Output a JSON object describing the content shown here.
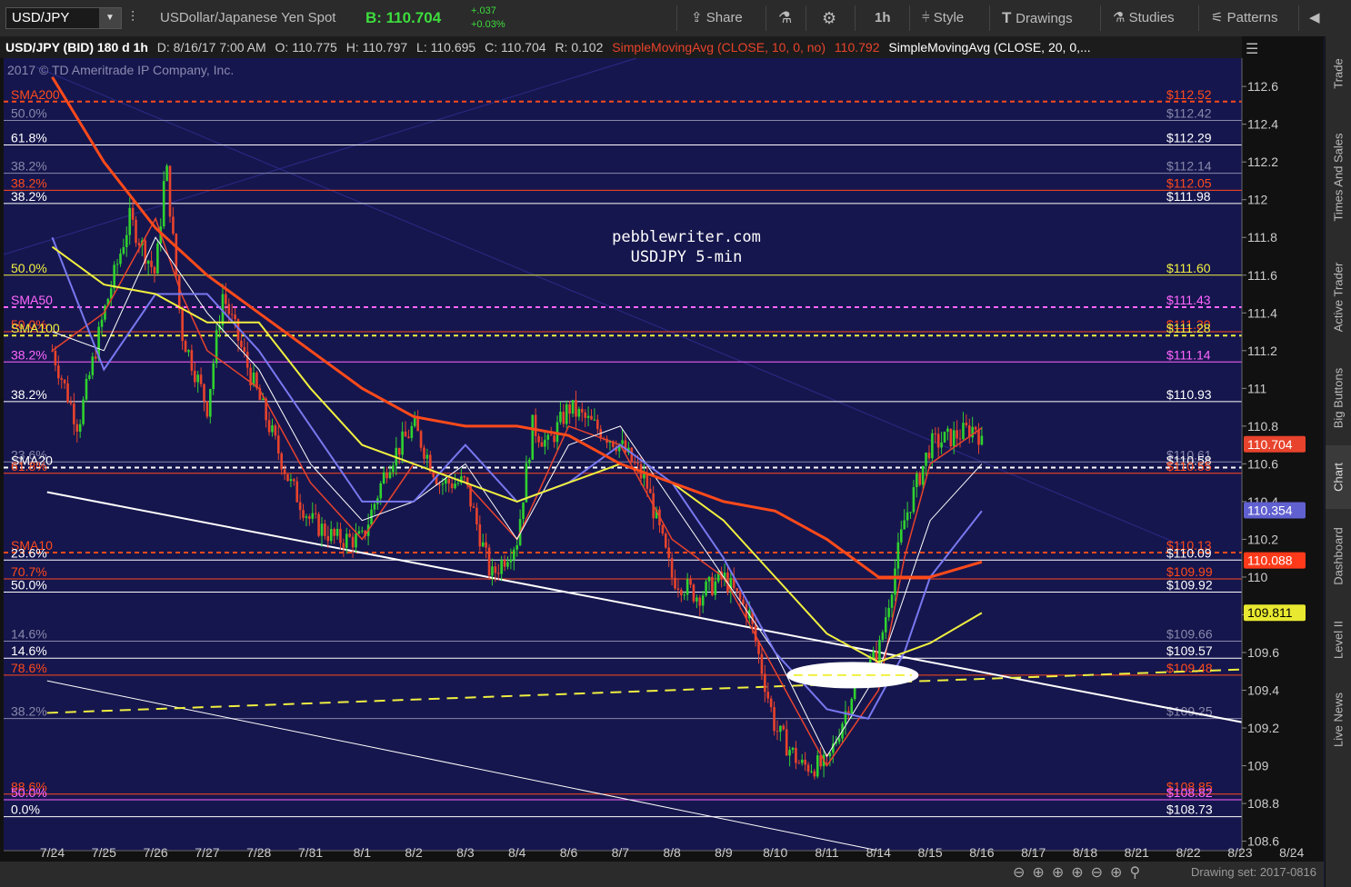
{
  "toolbar": {
    "symbol": "USD/JPY",
    "description": "USDollar/Japanese Yen Spot",
    "bid_label": "B: 110.704",
    "change_abs": "+.037",
    "change_pct": "+0.03%",
    "share": "Share",
    "interval": "1h",
    "style": "Style",
    "drawings": "Drawings",
    "studies": "Studies",
    "patterns": "Patterns"
  },
  "infobar": {
    "title": "USD/JPY (BID) 180 d 1h",
    "date": "D: 8/16/17 7:00 AM",
    "open": "O: 110.775",
    "high": "H: 110.797",
    "low": "L: 110.695",
    "close": "C: 110.704",
    "range": "R: 0.102",
    "sma10": "SimpleMovingAvg (CLOSE, 10, 0, no)",
    "sma10_val": "110.792",
    "sma20": "SimpleMovingAvg (CLOSE, 20, 0,..."
  },
  "side_tabs": [
    "Trade",
    "Times And Sales",
    "Active Trader",
    "Big Buttons",
    "Chart",
    "Dashboard",
    "Level II",
    "Live News"
  ],
  "bottom": {
    "drawing_set": "Drawing set: 2017-0816"
  },
  "colors": {
    "bg": "#16164e",
    "candle_up": "#2fd12f",
    "candle_down": "#e8432c",
    "sma10": "#e8432c",
    "sma20": "#ffffff",
    "sma50": "#7878f0",
    "sma100": "#f0f040",
    "sma200": "#ff4a1a"
  },
  "chart_data": {
    "type": "candlestick",
    "watermark": "2017 © TD Ameritrade IP Company, Inc.",
    "annotation": [
      "pebblewriter.com",
      "USDJPY 5-min"
    ],
    "x_ticks": [
      "7/24",
      "7/25",
      "7/26",
      "7/27",
      "7/28",
      "7/31",
      "8/1",
      "8/2",
      "8/3",
      "8/4",
      "8/6",
      "8/7",
      "8/8",
      "8/9",
      "8/10",
      "8/11",
      "8/14",
      "8/15",
      "8/16",
      "8/17",
      "8/18",
      "8/21",
      "8/22",
      "8/23",
      "8/24"
    ],
    "ylim": [
      108.55,
      112.75
    ],
    "y_ticks": [
      108.6,
      108.8,
      109,
      109.2,
      109.4,
      109.6,
      109.8,
      110,
      110.2,
      110.4,
      110.6,
      110.8,
      111,
      111.2,
      111.4,
      111.6,
      111.8,
      112,
      112.2,
      112.4,
      112.6
    ],
    "y_tick_labels": [
      "108.6",
      "108.8",
      "109",
      "109.2",
      "109.4",
      "109.6",
      "",
      "110",
      "110.2",
      "110.4",
      "110.6",
      "110.8",
      "111",
      "111.2",
      "111.4",
      "111.6",
      "111.8",
      "112",
      "112.2",
      "112.4",
      "112.6"
    ],
    "price_path": [
      [
        0,
        111.2
      ],
      [
        0.5,
        110.8
      ],
      [
        1,
        111.4
      ],
      [
        1.5,
        111.9
      ],
      [
        2,
        111.6
      ],
      [
        2.2,
        112.2
      ],
      [
        2.5,
        111.3
      ],
      [
        3,
        110.9
      ],
      [
        3.3,
        111.5
      ],
      [
        3.8,
        111.1
      ],
      [
        4.2,
        110.8
      ],
      [
        4.6,
        110.5
      ],
      [
        5,
        110.3
      ],
      [
        5.5,
        110.2
      ],
      [
        6,
        110.2
      ],
      [
        6.5,
        110.6
      ],
      [
        7,
        110.8
      ],
      [
        7.5,
        110.5
      ],
      [
        8,
        110.5
      ],
      [
        8.5,
        110.0
      ],
      [
        9,
        110.2
      ],
      [
        9.3,
        110.8
      ],
      [
        9.6,
        110.7
      ],
      [
        10,
        110.9
      ],
      [
        10.5,
        110.8
      ],
      [
        11,
        110.7
      ],
      [
        11.5,
        110.5
      ],
      [
        12,
        110.0
      ],
      [
        12.5,
        109.9
      ],
      [
        13,
        110.0
      ],
      [
        13.5,
        109.8
      ],
      [
        14,
        109.2
      ],
      [
        14.5,
        109.0
      ],
      [
        15,
        109.0
      ],
      [
        15.5,
        109.4
      ],
      [
        16,
        109.6
      ],
      [
        16.5,
        110.3
      ],
      [
        17,
        110.7
      ],
      [
        17.5,
        110.75
      ],
      [
        17.9,
        110.8
      ],
      [
        18,
        110.7
      ]
    ],
    "candle_base": [
      111.1,
      110.9,
      111.2,
      111.6,
      111.9,
      111.8,
      111.95,
      111.9,
      111.0,
      111.3,
      111.0,
      111.2,
      111.0,
      110.8,
      110.6,
      110.5,
      110.3,
      110.3,
      110.2,
      110.2,
      110.4,
      110.5,
      110.8,
      110.7,
      110.6,
      110.5,
      110.3,
      110.1,
      110.2,
      110.5,
      110.8,
      110.8,
      110.7,
      110.8,
      110.9,
      110.8,
      110.6,
      110.6,
      110.5,
      110.2,
      110.0,
      109.9,
      110.0,
      109.8,
      109.9,
      109.5,
      109.2,
      109.1,
      109.0,
      109.0,
      109.2,
      109.4,
      109.5,
      109.6,
      110.0,
      110.3,
      110.5,
      110.7,
      110.7,
      110.8,
      110.75
    ],
    "series": [
      {
        "name": "SMA10",
        "values": [
          [
            0,
            111.2
          ],
          [
            1,
            111.4
          ],
          [
            2,
            111.9
          ],
          [
            2.5,
            111.5
          ],
          [
            3,
            111.2
          ],
          [
            4,
            111.0
          ],
          [
            5,
            110.5
          ],
          [
            6,
            110.2
          ],
          [
            7,
            110.6
          ],
          [
            8,
            110.5
          ],
          [
            9,
            110.2
          ],
          [
            10,
            110.8
          ],
          [
            11,
            110.7
          ],
          [
            12,
            110.2
          ],
          [
            13,
            110.0
          ],
          [
            14,
            109.5
          ],
          [
            15,
            109.0
          ],
          [
            16,
            109.4
          ],
          [
            16.5,
            110.1
          ],
          [
            17,
            110.6
          ],
          [
            18,
            110.79
          ]
        ]
      },
      {
        "name": "SMA20",
        "values": [
          [
            0,
            111.3
          ],
          [
            1,
            111.2
          ],
          [
            2,
            111.8
          ],
          [
            3,
            111.4
          ],
          [
            4,
            111.1
          ],
          [
            5,
            110.6
          ],
          [
            6,
            110.3
          ],
          [
            7,
            110.4
          ],
          [
            8,
            110.6
          ],
          [
            9,
            110.2
          ],
          [
            10,
            110.7
          ],
          [
            11,
            110.8
          ],
          [
            12,
            110.4
          ],
          [
            13,
            110.0
          ],
          [
            14,
            109.6
          ],
          [
            15,
            109.05
          ],
          [
            16,
            109.5
          ],
          [
            17,
            110.3
          ],
          [
            18,
            110.6
          ]
        ]
      },
      {
        "name": "SMA50",
        "values": [
          [
            0,
            111.8
          ],
          [
            1,
            111.1
          ],
          [
            2,
            111.5
          ],
          [
            3,
            111.5
          ],
          [
            4,
            111.2
          ],
          [
            5,
            110.8
          ],
          [
            6,
            110.4
          ],
          [
            7,
            110.4
          ],
          [
            8,
            110.7
          ],
          [
            9,
            110.4
          ],
          [
            10,
            110.5
          ],
          [
            11,
            110.7
          ],
          [
            12,
            110.5
          ],
          [
            13,
            110.1
          ],
          [
            14,
            109.6
          ],
          [
            15,
            109.3
          ],
          [
            15.8,
            109.25
          ],
          [
            16.5,
            109.6
          ],
          [
            17,
            110.0
          ],
          [
            18,
            110.35
          ]
        ]
      },
      {
        "name": "SMA100",
        "values": [
          [
            0,
            111.75
          ],
          [
            1,
            111.55
          ],
          [
            2,
            111.5
          ],
          [
            3,
            111.35
          ],
          [
            4,
            111.35
          ],
          [
            5,
            111.0
          ],
          [
            6,
            110.7
          ],
          [
            7,
            110.6
          ],
          [
            8,
            110.5
          ],
          [
            9,
            110.4
          ],
          [
            10,
            110.5
          ],
          [
            11,
            110.6
          ],
          [
            12,
            110.5
          ],
          [
            13,
            110.3
          ],
          [
            14,
            110.0
          ],
          [
            15,
            109.7
          ],
          [
            16,
            109.55
          ],
          [
            17,
            109.65
          ],
          [
            18,
            109.81
          ]
        ]
      },
      {
        "name": "SMA200",
        "values": [
          [
            0,
            112.65
          ],
          [
            1,
            112.2
          ],
          [
            2,
            111.85
          ],
          [
            3,
            111.6
          ],
          [
            4,
            111.4
          ],
          [
            5,
            111.2
          ],
          [
            6,
            111.0
          ],
          [
            7,
            110.85
          ],
          [
            8,
            110.8
          ],
          [
            9,
            110.8
          ],
          [
            10,
            110.75
          ],
          [
            11,
            110.6
          ],
          [
            12,
            110.5
          ],
          [
            13,
            110.4
          ],
          [
            14,
            110.35
          ],
          [
            15,
            110.2
          ],
          [
            16,
            110.0
          ],
          [
            17,
            110.0
          ],
          [
            18,
            110.08
          ]
        ]
      }
    ],
    "h_levels": [
      {
        "y": 112.52,
        "color": "#ff4a1a",
        "dash": true,
        "left": "SMA200",
        "right": "$112.52",
        "lc": "#ff4a1a"
      },
      {
        "y": 112.42,
        "color": "#8888aa",
        "dash": false,
        "left": "50.0%",
        "right": "$112.42",
        "lc": "#8888aa"
      },
      {
        "y": 112.29,
        "color": "#ffffff",
        "dash": false,
        "left": "61.8%",
        "right": "$112.29",
        "lc": "#ffffff"
      },
      {
        "y": 112.14,
        "color": "#8888aa",
        "dash": false,
        "left": "38.2%",
        "right": "$112.14",
        "lc": "#8888aa"
      },
      {
        "y": 112.05,
        "color": "#ff4a1a",
        "dash": false,
        "left": "38.2%",
        "right": "$112.05",
        "lc": "#ff4a1a"
      },
      {
        "y": 111.98,
        "color": "#ffffff",
        "dash": false,
        "left": "38.2%",
        "right": "$111.98",
        "lc": "#ffffff"
      },
      {
        "y": 111.6,
        "color": "#f0f040",
        "dash": false,
        "left": "50.0%",
        "right": "$111.60",
        "lc": "#f0f040"
      },
      {
        "y": 111.43,
        "color": "#ff66ff",
        "dash": true,
        "left": "SMA50",
        "right": "$111.43",
        "lc": "#ff66ff"
      },
      {
        "y": 111.3,
        "color": "#ff4a1a",
        "dash": false,
        "left": "50.0%",
        "right": "$111.30",
        "lc": "#ff4a1a"
      },
      {
        "y": 111.28,
        "color": "#f0f040",
        "dash": true,
        "left": "SMA100",
        "right": "$111.28",
        "lc": "#f0f040"
      },
      {
        "y": 111.14,
        "color": "#ff66ff",
        "dash": false,
        "left": "38.2%",
        "right": "$111.14",
        "lc": "#ff66ff"
      },
      {
        "y": 110.93,
        "color": "#ffffff",
        "dash": false,
        "left": "38.2%",
        "right": "$110.93",
        "lc": "#ffffff"
      },
      {
        "y": 110.61,
        "color": "#8888aa",
        "dash": false,
        "left": "23.6%",
        "right": "$110.61",
        "lc": "#8888aa"
      },
      {
        "y": 110.58,
        "color": "#ffffff",
        "dash": true,
        "left": "SMA20",
        "right": "$110.58",
        "lc": "#ffffff"
      },
      {
        "y": 110.55,
        "color": "#ff4a1a",
        "dash": false,
        "left": "61.8%",
        "right": "$110.55",
        "lc": "#ff4a1a"
      },
      {
        "y": 110.13,
        "color": "#ff4a1a",
        "dash": true,
        "left": "SMA10",
        "right": "$110.13",
        "lc": "#ff4a1a"
      },
      {
        "y": 110.09,
        "color": "#ffffff",
        "dash": false,
        "left": "23.6%",
        "right": "$110.09",
        "lc": "#ffffff"
      },
      {
        "y": 109.99,
        "color": "#ff4a1a",
        "dash": false,
        "left": "70.7%",
        "right": "$109.99",
        "lc": "#ff4a1a"
      },
      {
        "y": 109.92,
        "color": "#ffffff",
        "dash": false,
        "left": "50.0%",
        "right": "$109.92",
        "lc": "#ffffff"
      },
      {
        "y": 109.66,
        "color": "#8888aa",
        "dash": false,
        "left": "14.6%",
        "right": "$109.66",
        "lc": "#8888aa"
      },
      {
        "y": 109.57,
        "color": "#ffffff",
        "dash": false,
        "left": "14.6%",
        "right": "$109.57",
        "lc": "#ffffff"
      },
      {
        "y": 109.48,
        "color": "#ff4a1a",
        "dash": false,
        "left": "78.6%",
        "right": "$109.48",
        "lc": "#ff4a1a"
      },
      {
        "y": 109.25,
        "color": "#8888aa",
        "dash": false,
        "left": "38.2%",
        "right": "$109.25",
        "lc": "#8888aa"
      },
      {
        "y": 108.85,
        "color": "#ff4a1a",
        "dash": false,
        "left": "88.6%",
        "right": "$108.85",
        "lc": "#ff4a1a"
      },
      {
        "y": 108.82,
        "color": "#ff66ff",
        "dash": false,
        "left": "50.0%",
        "right": "$108.82",
        "lc": "#ff66ff"
      },
      {
        "y": 108.73,
        "color": "#ffffff",
        "dash": false,
        "left": "0.0%",
        "right": "$108.73",
        "lc": "#ffffff"
      }
    ],
    "trendlines": [
      {
        "x1": -0.1,
        "y1": 110.45,
        "x2": 24,
        "y2": 109.18,
        "color": "#ffffff",
        "width": 2,
        "dash": false
      },
      {
        "x1": -0.1,
        "y1": 109.45,
        "x2": 16,
        "y2": 108.55,
        "color": "#ffffff",
        "width": 1,
        "dash": false
      },
      {
        "x1": -0.1,
        "y1": 109.28,
        "x2": 24,
        "y2": 109.52,
        "color": "#f0f040",
        "width": 2,
        "dash": true
      }
    ],
    "price_tags": [
      {
        "y": 110.704,
        "text": "110.704",
        "bg": "#e8432c",
        "fg": "#ffffff"
      },
      {
        "y": 110.354,
        "text": "110.354",
        "bg": "#6060d0",
        "fg": "#ffffff"
      },
      {
        "y": 110.088,
        "text": "110.088",
        "bg": "#ff3a1a",
        "fg": "#ffffff"
      },
      {
        "y": 109.811,
        "text": "109.811",
        "bg": "#e8e830",
        "fg": "#000000"
      }
    ],
    "highlight": {
      "x": 15.5,
      "y": 109.48
    }
  }
}
